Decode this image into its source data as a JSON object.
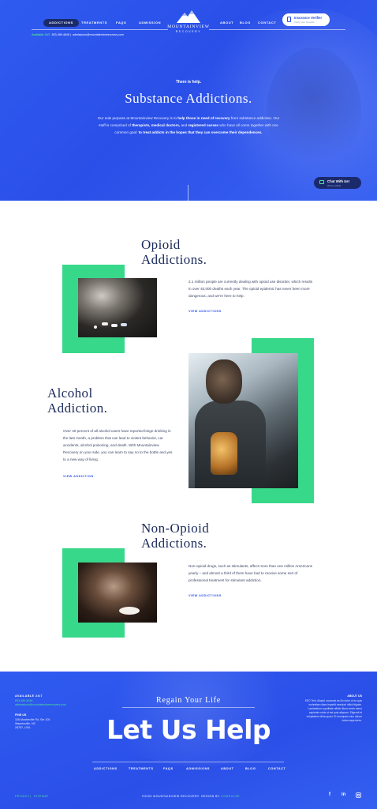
{
  "header": {
    "nav_left": [
      "ADDICTIONS",
      "TREATMENTS",
      "FAQS",
      "ADMISSION"
    ],
    "nav_right": [
      "ABOUT",
      "BLOG",
      "CONTACT"
    ],
    "logo_name": "MOUNTAINVIEW",
    "logo_sub": "RECOVERY",
    "insurance_title": "Insurance Verifier",
    "insurance_sub": "Verify your benefits",
    "available_label": "Available 24/7",
    "phone": "833-489-4646",
    "email": "admissions@mountainviewrecovery.com"
  },
  "hero": {
    "kicker": "There is help.",
    "title": "Substance Addictions.",
    "desc_1": "Our sole purpose at Mountainview Recovery is to ",
    "desc_b1": "help those in need of recovery",
    "desc_2": " from substance addiction. Our staff is comprised of ",
    "desc_b2": "therapists, medical doctors,",
    "desc_3": " and ",
    "desc_b3": "registered nurses",
    "desc_4": " who have all come together with one common goal: ",
    "desc_b4": "to treat addicts in the hopes that they can overcome their dependences.",
    "chat_title": "Chat With Us!",
    "chat_sub": "We're online!"
  },
  "sections": {
    "opioid": {
      "title_1": "Opioid",
      "title_2": "Addictions.",
      "text": "2.1 million people are currently dealing with opioid use disorder, which results in over 40,000 deaths each year. The opioid epidemic has never been more dangerous, and we're here to help.",
      "link": "VIEW ADDICTIONS"
    },
    "alcohol": {
      "title_1": "Alcohol",
      "title_2": "Addiction.",
      "text": "Over 40 percent of all alcohol users have reported binge drinking in the last month, a problem that can lead to violent behavior, car accidents, alcohol poisoning, and death. With Mountainview Recovery on your side, you can learn to say no to the bottle and yes to a new way of living.",
      "link": "VIEW ADDICTION"
    },
    "nonopioid": {
      "title_1": "Non-Opioid",
      "title_2": "Addictions.",
      "text": "Non-opioid drugs, such as stimulants, affect more than one million Americans yearly – and almost a third of them have had to receive some sort of professional treatment for stimulant addiction.",
      "link": "VIEW ADDICTIONS"
    }
  },
  "footer": {
    "regain": "Regain Your Life",
    "help": "Let Us Help",
    "available_h": "AVAILABLE 24/7",
    "phone": "833-489-4646",
    "email": "admissions@mountainviewrecovery.com",
    "find_h": "FIND US",
    "addr_1": "106 Montreville Rd, Ste 100",
    "addr_2": "Waynesville, NC",
    "addr_3": "28787, USA",
    "about_h": "ABOUT US",
    "about_text": "SEO Text. Aliquid occaecat as illo dolor of ea quis molestiae ullam impedit nesciunt officii dignim. Laudantium cupiditate officiis libero enim nemo sapiente nobis ut est quia aliquam. Eligendi et voluptatem dicta quasi. Et numquam eius dolore totam asperiores.",
    "nav": [
      "ADDICTIONS",
      "TREATMENTS",
      "FAQS",
      "ADMISSIONS",
      "ABOUT",
      "BLOG",
      "CONTACT"
    ],
    "privacy": "PRIVACY",
    "sitemap": "SITEMAP",
    "copyright": "©2020 MOUNTAINVIEW RECOVERY. DESIGN BY",
    "designer": "COMPULSE",
    "social": [
      "f",
      "in",
      "ig"
    ]
  },
  "colors": {
    "brand_blue": "#2a4fe8",
    "navy": "#1a2a6b",
    "accent_green": "#37d88a",
    "text_dark": "#1b2a5a"
  }
}
